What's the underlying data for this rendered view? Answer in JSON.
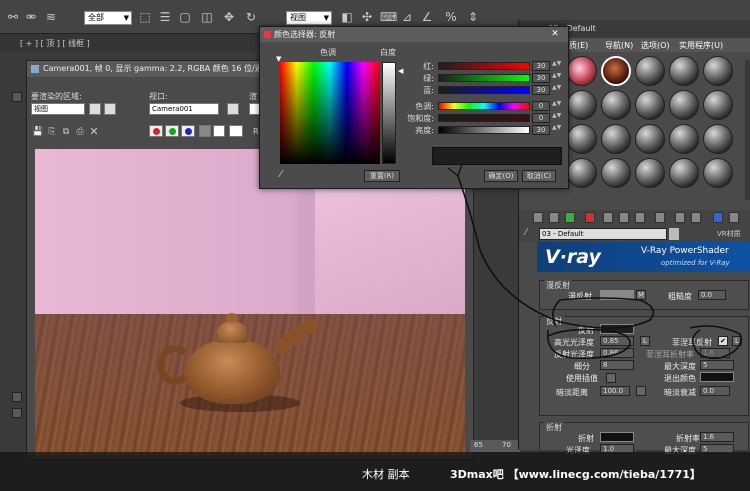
{
  "toolbar": {
    "selection_filter": "全部",
    "ref_coord": "视图"
  },
  "viewport_label": "[ + ] [ 顶 ] [ 线框 ]",
  "render_window": {
    "title": "Camera001, 帧 0, 显示 gamma: 2.2, RGBA 颜色 16 位/通道",
    "area_label": "要渲染的区域:",
    "area_value": "视图",
    "viewport_label": "视口:",
    "viewport_value": "Camera001",
    "preset_label": "渲",
    "preset_value": "黑",
    "misc_label": "质",
    "channel_label": "RG"
  },
  "color_picker": {
    "title": "颜色选择器: 反射",
    "hue_header": "色调",
    "whiteness_header": "白度",
    "rows": [
      {
        "label": "红:",
        "value": "30"
      },
      {
        "label": "绿:",
        "value": "30"
      },
      {
        "label": "蓝:",
        "value": "30"
      },
      {
        "label": "色调:",
        "value": "0"
      },
      {
        "label": "饱和度:",
        "value": "0"
      },
      {
        "label": "亮度:",
        "value": "30"
      }
    ],
    "reset_button": "重置(R)",
    "ok_button": "确定(O)",
    "cancel_button": "取消(C)",
    "current_color": "#1e1e1e"
  },
  "material_editor": {
    "title": "材质编辑器 - 03 - Default",
    "title_visible": "- 03 - Default",
    "menu": [
      "质(E)",
      "导航(N)",
      "选项(O)",
      "实用程序(U)"
    ],
    "material_name": "03 - Default",
    "material_type": "VR材质",
    "banner_logo": "V·ray",
    "banner_title": "V-Ray PowerShader",
    "banner_sub": "optimized for V-Ray",
    "diffuse_section": "漫反射",
    "diffuse_label": "漫反射",
    "diffuse_btn": "M",
    "roughness_label": "粗糙度",
    "roughness_value": "0.0",
    "reflection_section": "反射",
    "reflect_label": "反射",
    "hilight_gloss_label": "高光光泽度",
    "hilight_gloss_value": "0.85",
    "refl_gloss_label": "反射光泽度",
    "refl_gloss_value": "0.86",
    "subdivs_label": "细分",
    "subdivs_value": "8",
    "use_interp_label": "使用插值",
    "dim_dist_label": "暗淡距离",
    "dim_dist_value": "100.0",
    "lock_btn": "L",
    "fresnel_label": "菲涅耳反射",
    "fresnel_ior_label": "菲涅耳折射率",
    "fresnel_ior_value": "1.6",
    "max_depth_label": "最大深度",
    "max_depth_value": "5",
    "exit_color_label": "退出颜色",
    "dim_falloff_label": "暗淡衰减",
    "dim_falloff_value": "0.0",
    "refraction_section": "折射",
    "refract_label": "折射",
    "ior_label": "折射率",
    "ior_value": "1.6",
    "r_gloss_label": "光泽度",
    "r_gloss_value": "1.0",
    "r_max_depth_label": "最大深度",
    "r_max_depth_value": "5",
    "r_subdivs_label": "细分",
    "r_subdivs_value": "8",
    "r_exit_label": "退出颜色",
    "use_interp2_label": "使用插值",
    "affect_shadow_label": "影响阴影"
  },
  "ruler": {
    "tick_a": "65",
    "tick_b": "70"
  },
  "caption": "木材 副本",
  "watermark": "3Dmax吧 【www.linecg.com/tieba/1771】",
  "colors": {
    "accent": "#0f52a3",
    "wall": "#e8b8d4",
    "wood": "#8b5533",
    "ink": "#111111"
  }
}
